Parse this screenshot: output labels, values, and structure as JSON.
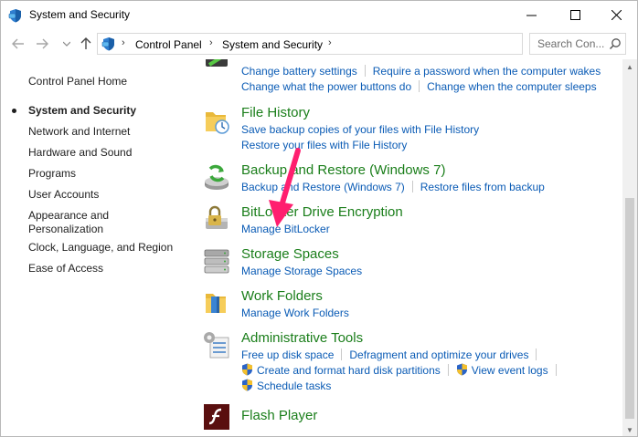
{
  "window": {
    "title": "System and Security",
    "accent": "#0a5bb5"
  },
  "address": {
    "crumbs": [
      "Control Panel",
      "System and Security"
    ],
    "search_placeholder": "Search Con..."
  },
  "sidebar": {
    "home": "Control Panel Home",
    "items": [
      {
        "label": "System and Security",
        "active": true
      },
      {
        "label": "Network and Internet"
      },
      {
        "label": "Hardware and Sound"
      },
      {
        "label": "Programs"
      },
      {
        "label": "User Accounts"
      },
      {
        "label": "Appearance and\nPersonalization"
      },
      {
        "label": "Clock, Language, and Region"
      },
      {
        "label": "Ease of Access"
      }
    ]
  },
  "categories": [
    {
      "title": "",
      "icon": "power-options-icon",
      "links": [
        [
          "Change battery settings",
          "Require a password when the computer wakes"
        ],
        [
          "Change what the power buttons do",
          "Change when the computer sleeps"
        ]
      ]
    },
    {
      "title": "File History",
      "icon": "file-history-icon",
      "links": [
        [
          "Save backup copies of your files with File History"
        ],
        [
          "Restore your files with File History"
        ]
      ]
    },
    {
      "title": "Backup and Restore (Windows 7)",
      "icon": "backup-restore-icon",
      "links": [
        [
          "Backup and Restore (Windows 7)",
          "Restore files from backup"
        ]
      ]
    },
    {
      "title": "BitLocker Drive Encryption",
      "icon": "bitlocker-icon",
      "links": [
        [
          "Manage BitLocker"
        ]
      ]
    },
    {
      "title": "Storage Spaces",
      "icon": "storage-spaces-icon",
      "links": [
        [
          "Manage Storage Spaces"
        ]
      ]
    },
    {
      "title": "Work Folders",
      "icon": "work-folders-icon",
      "links": [
        [
          "Manage Work Folders"
        ]
      ]
    },
    {
      "title": "Administrative Tools",
      "icon": "administrative-tools-icon",
      "links": [
        [
          "Free up disk space",
          "Defragment and optimize your drives"
        ],
        [
          "Create and format hard disk partitions",
          "View event logs"
        ],
        [
          "Schedule tasks"
        ]
      ]
    },
    {
      "title": "Flash Player",
      "icon": "flash-player-icon",
      "links": []
    }
  ],
  "annotation": {
    "color": "#ff1f6f"
  }
}
